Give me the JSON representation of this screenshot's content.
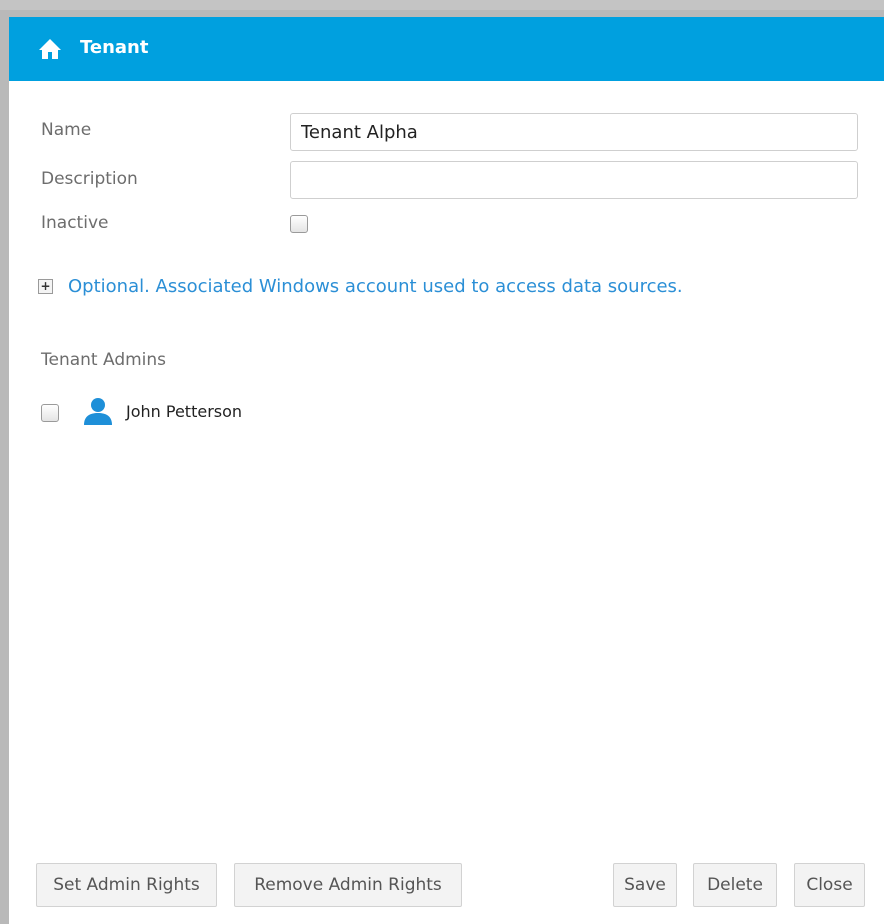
{
  "dialog": {
    "title": "Tenant",
    "title_icon": "home-icon",
    "accent_color": "#00a0df"
  },
  "form": {
    "name_label": "Name",
    "name_value": "Tenant Alpha",
    "description_label": "Description",
    "description_value": "",
    "inactive_label": "Inactive",
    "inactive_checked": false
  },
  "optional": {
    "expand_symbol": "+",
    "link_text": "Optional. Associated Windows account used to access data sources."
  },
  "admins": {
    "title": "Tenant Admins",
    "users": [
      {
        "name": "John Petterson",
        "icon": "user-icon",
        "checked": false
      }
    ]
  },
  "buttons": {
    "set_admin": "Set Admin Rights",
    "remove_admin": "Remove Admin Rights",
    "save": "Save",
    "delete": "Delete",
    "close": "Close"
  }
}
